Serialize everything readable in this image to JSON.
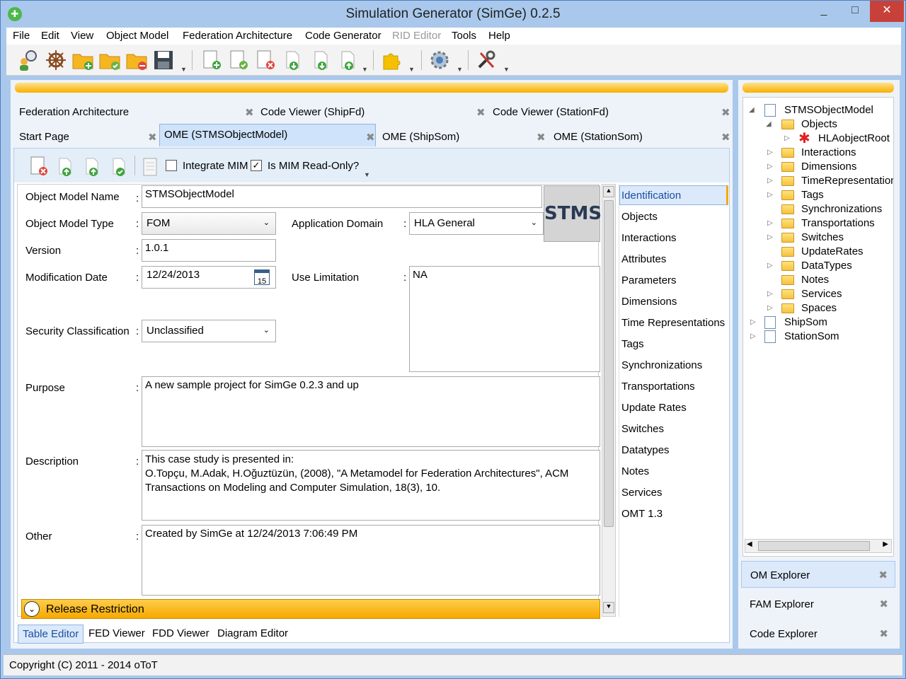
{
  "window": {
    "title": "Simulation Generator (SimGe) 0.2.5",
    "minimize": "_",
    "maximize": "□",
    "close": "✕"
  },
  "menu": [
    "File",
    "Edit",
    "View",
    "Object Model",
    "Federation Architecture",
    "Code Generator",
    "RID Editor",
    "Tools",
    "Help"
  ],
  "tabs_row1": [
    {
      "label": "Federation Architecture"
    },
    {
      "label": "Code Viewer (ShipFd)"
    },
    {
      "label": "Code Viewer (StationFd)"
    }
  ],
  "tabs_row2": [
    {
      "label": "Start Page"
    },
    {
      "label": "OME (STMSObjectModel)"
    },
    {
      "label": "OME (ShipSom)"
    },
    {
      "label": "OME (StationSom)"
    }
  ],
  "tab_close": "✖",
  "editor_toolbar": {
    "integrate_mim": "Integrate MIM",
    "is_mim_readonly": "Is MIM Read-Only?",
    "readonly_checked": true
  },
  "form": {
    "object_model_name_label": "Object Model Name",
    "object_model_name": "STMSObjectModel",
    "object_model_type_label": "Object Model Type",
    "object_model_type": "FOM",
    "application_domain_label": "Application Domain",
    "application_domain": "HLA General",
    "version_label": "Version",
    "version": "1.0.1",
    "modification_date_label": "Modification Date",
    "modification_date": "12/24/2013",
    "calendar_day": "15",
    "use_limitation_label": "Use Limitation",
    "use_limitation": "NA",
    "security_label": "Security Classification",
    "security": "Unclassified",
    "purpose_label": "Purpose",
    "purpose": "A new sample project for SimGe 0.2.3 and up",
    "description_label": "Description",
    "description_lines": [
      "This case study is presented in:",
      "O.Topçu, M.Adak, H.Oğuztüzün, (2008), \"A Metamodel for Federation Architectures\", ACM",
      "Transactions on Modeling and Computer Simulation, 18(3), 10."
    ],
    "other_label": "Other",
    "other": "Created by SimGe at 12/24/2013 7:06:49 PM",
    "logo": "STMS",
    "release_restriction": "Release Restriction",
    "colon": ":"
  },
  "side_nav": [
    "Identification",
    "Objects",
    "Interactions",
    "Attributes",
    "Parameters",
    "Dimensions",
    "Time Representations",
    "Tags",
    "Synchronizations",
    "Transportations",
    "Update Rates",
    "Switches",
    "Datatypes",
    "Notes",
    "Services",
    "OMT 1.3"
  ],
  "bottom_tabs": [
    "Table Editor",
    "FED Viewer",
    "FDD Viewer",
    "Diagram Editor"
  ],
  "tree": {
    "root": "STMSObjectModel",
    "objects": "Objects",
    "hla_root": "HLAobjectRoot",
    "children": [
      "Interactions",
      "Dimensions",
      "TimeRepresentation",
      "Tags",
      "Synchronizations",
      "Transportations",
      "Switches",
      "UpdateRates",
      "DataTypes",
      "Notes",
      "Services",
      "Spaces"
    ],
    "others": [
      "ShipSom",
      "StationSom"
    ]
  },
  "explorers": [
    "OM Explorer",
    "FAM Explorer",
    "Code Explorer"
  ],
  "status": "Copyright (C) 2011 - 2014 oToT",
  "colors": {
    "accent": "#f7b000",
    "frame": "#a9c8ec",
    "selected": "#cfe3fa"
  }
}
